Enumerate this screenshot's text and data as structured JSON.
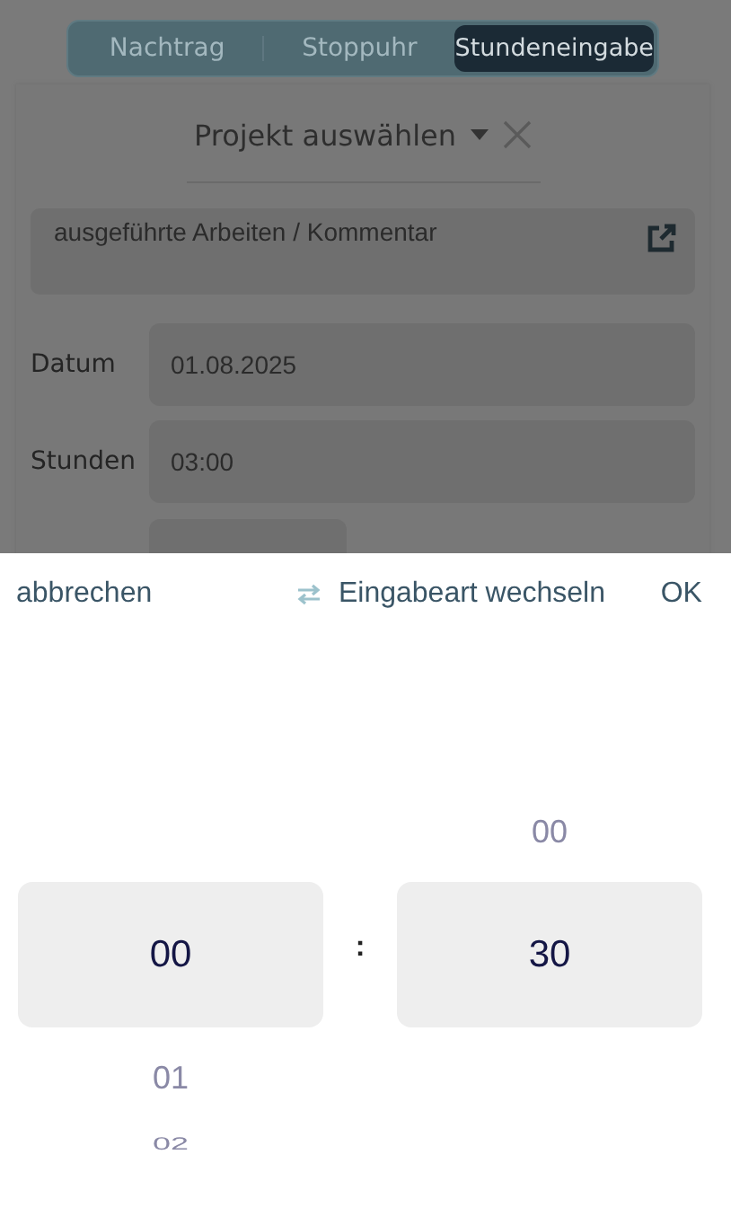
{
  "segments": [
    {
      "label": "Nachtrag",
      "selected": false
    },
    {
      "label": "Stoppuhr",
      "selected": false
    },
    {
      "label": "Stundeneingabe",
      "selected": true
    }
  ],
  "project_select": {
    "label": "Projekt auswählen"
  },
  "comment_field": {
    "placeholder": "ausgeführte Arbeiten / Kommentar"
  },
  "fields": [
    {
      "label": "Datum",
      "value": "01.08.2025"
    },
    {
      "label": "Stunden",
      "value": "03:00"
    }
  ],
  "picker": {
    "cancel": "abbrechen",
    "switch_mode": "Eingabeart wechseln",
    "confirm": "OK",
    "separator": ":",
    "columns": [
      {
        "items": [
          {
            "label": "00",
            "selected": true
          },
          {
            "label": "01",
            "selected": false
          },
          {
            "label": "02",
            "selected": false
          }
        ]
      },
      {
        "items": [
          {
            "label": "00",
            "selected": false
          },
          {
            "label": "30",
            "selected": true
          }
        ]
      }
    ]
  }
}
